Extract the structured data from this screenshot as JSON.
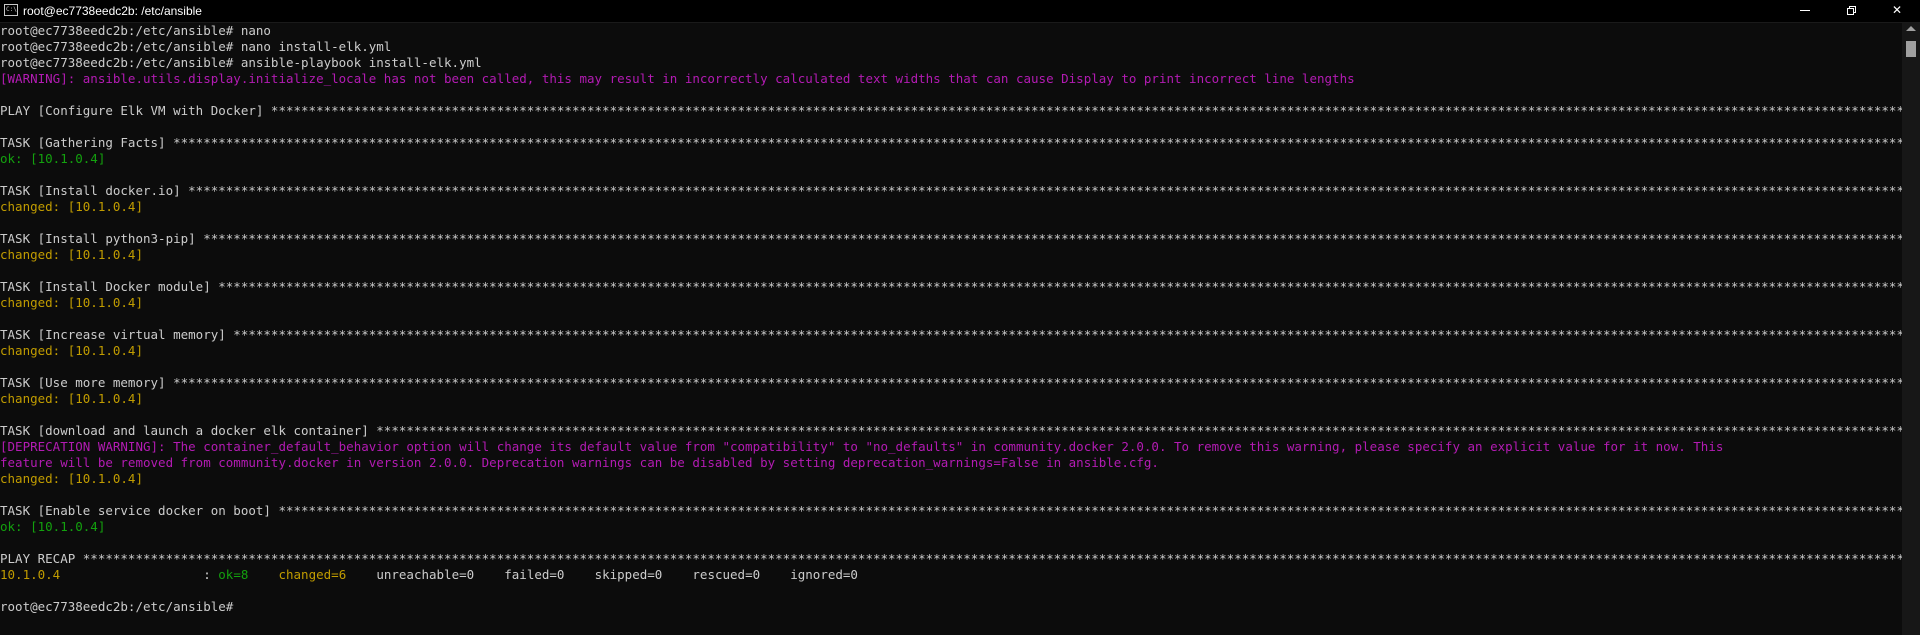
{
  "window": {
    "title": "root@ec7738eedc2b: /etc/ansible",
    "icon": "console-icon",
    "controls": {
      "minimize": "minimize-icon",
      "maximize": "restore-icon",
      "close": "✕"
    }
  },
  "terminal": {
    "colors": {
      "default": "#cccccc",
      "ok": "#13a10e",
      "changed": "#c19c00",
      "warning": "#b31bb3",
      "background": "#0c0c0c"
    },
    "lines": [
      {
        "segments": [
          {
            "text": "root@ec7738eedc2b:/etc/ansible# nano",
            "color": "default"
          }
        ]
      },
      {
        "segments": [
          {
            "text": "root@ec7738eedc2b:/etc/ansible# nano install-elk.yml",
            "color": "default"
          }
        ]
      },
      {
        "segments": [
          {
            "text": "root@ec7738eedc2b:/etc/ansible# ansible-playbook install-elk.yml",
            "color": "default"
          }
        ]
      },
      {
        "segments": [
          {
            "text": "[WARNING]: ansible.utils.display.initialize_locale has not been called, this may result in incorrectly calculated text widths that can cause Display to print incorrect line lengths",
            "color": "warn"
          }
        ]
      },
      {
        "segments": [
          {
            "text": "",
            "color": "default"
          }
        ]
      },
      {
        "segments": [
          {
            "text": "PLAY [Configure Elk VM with Docker] *********************************************************************************************************************************************************************************************************************************************************************************************************************************************************************",
            "color": "default"
          }
        ]
      },
      {
        "segments": [
          {
            "text": "",
            "color": "default"
          }
        ]
      },
      {
        "segments": [
          {
            "text": "TASK [Gathering Facts] **********************************************************************************************************************************************************************************************************************************************************************************************************************************************************************************",
            "color": "default"
          }
        ]
      },
      {
        "segments": [
          {
            "text": "ok: [10.1.0.4]",
            "color": "ok"
          }
        ]
      },
      {
        "segments": [
          {
            "text": "",
            "color": "default"
          }
        ]
      },
      {
        "segments": [
          {
            "text": "TASK [Install docker.io] ********************************************************************************************************************************************************************************************************************************************************************************************************************************************************************************",
            "color": "default"
          }
        ]
      },
      {
        "segments": [
          {
            "text": "changed: [10.1.0.4]",
            "color": "changed"
          }
        ]
      },
      {
        "segments": [
          {
            "text": "",
            "color": "default"
          }
        ]
      },
      {
        "segments": [
          {
            "text": "TASK [Install python3-pip] ******************************************************************************************************************************************************************************************************************************************************************************************************************************************************************************",
            "color": "default"
          }
        ]
      },
      {
        "segments": [
          {
            "text": "changed: [10.1.0.4]",
            "color": "changed"
          }
        ]
      },
      {
        "segments": [
          {
            "text": "",
            "color": "default"
          }
        ]
      },
      {
        "segments": [
          {
            "text": "TASK [Install Docker module] ****************************************************************************************************************************************************************************************************************************************************************************************************************************************************************************",
            "color": "default"
          }
        ]
      },
      {
        "segments": [
          {
            "text": "changed: [10.1.0.4]",
            "color": "changed"
          }
        ]
      },
      {
        "segments": [
          {
            "text": "",
            "color": "default"
          }
        ]
      },
      {
        "segments": [
          {
            "text": "TASK [Increase virtual memory] **************************************************************************************************************************************************************************************************************************************************************************************************************************************************************************",
            "color": "default"
          }
        ]
      },
      {
        "segments": [
          {
            "text": "changed: [10.1.0.4]",
            "color": "changed"
          }
        ]
      },
      {
        "segments": [
          {
            "text": "",
            "color": "default"
          }
        ]
      },
      {
        "segments": [
          {
            "text": "TASK [Use more memory] **********************************************************************************************************************************************************************************************************************************************************************************************************************************************************************************",
            "color": "default"
          }
        ]
      },
      {
        "segments": [
          {
            "text": "changed: [10.1.0.4]",
            "color": "changed"
          }
        ]
      },
      {
        "segments": [
          {
            "text": "",
            "color": "default"
          }
        ]
      },
      {
        "segments": [
          {
            "text": "TASK [download and launch a docker elk container] ***********************************************************************************************************************************************************************************************************************************************************************************************************************************************",
            "color": "default"
          }
        ]
      },
      {
        "segments": [
          {
            "text": "[DEPRECATION WARNING]: The container_default_behavior option will change its default value from \"compatibility\" to \"no_defaults\" in community.docker 2.0.0. To remove this warning, please specify an explicit value for it now. This",
            "color": "warn"
          }
        ]
      },
      {
        "segments": [
          {
            "text": "feature will be removed from community.docker in version 2.0.0. Deprecation warnings can be disabled by setting deprecation_warnings=False in ansible.cfg.",
            "color": "warn"
          }
        ]
      },
      {
        "segments": [
          {
            "text": "changed: [10.1.0.4]",
            "color": "changed"
          }
        ]
      },
      {
        "segments": [
          {
            "text": "",
            "color": "default"
          }
        ]
      },
      {
        "segments": [
          {
            "text": "TASK [Enable service docker on boot] ********************************************************************************************************************************************************************************************************************************************************************************************************************************************************************",
            "color": "default"
          }
        ]
      },
      {
        "segments": [
          {
            "text": "ok: [10.1.0.4]",
            "color": "ok"
          }
        ]
      },
      {
        "segments": [
          {
            "text": "",
            "color": "default"
          }
        ]
      },
      {
        "segments": [
          {
            "text": "PLAY RECAP **************************************************************************************************************************************************************************************************************************************************************************************************************************************************************************************",
            "color": "default"
          }
        ]
      },
      {
        "segments": [
          {
            "text": "10.1.0.4",
            "color": "changed"
          },
          {
            "text": "                   : ",
            "color": "default"
          },
          {
            "text": "ok=8",
            "color": "ok"
          },
          {
            "text": "    ",
            "color": "default"
          },
          {
            "text": "changed=6",
            "color": "changed"
          },
          {
            "text": "    unreachable=0    failed=0    skipped=0    rescued=0    ignored=0",
            "color": "default"
          }
        ]
      },
      {
        "segments": [
          {
            "text": "",
            "color": "default"
          }
        ]
      },
      {
        "segments": [
          {
            "text": "root@ec7738eedc2b:/etc/ansible# ",
            "color": "default"
          }
        ]
      }
    ]
  }
}
